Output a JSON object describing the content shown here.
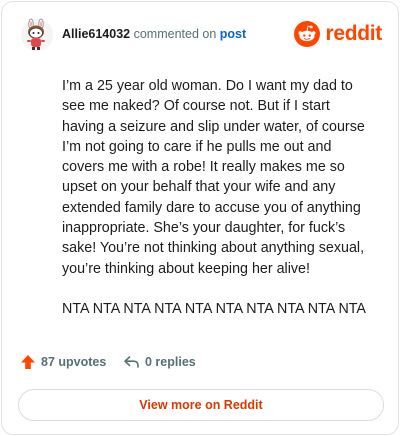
{
  "header": {
    "username": "Allie614032",
    "action_text": "commented on",
    "post_link": "post",
    "brand_wordmark": "reddit"
  },
  "comment": {
    "paragraphs": [
      "I’m a 25 year old woman. Do I want my dad to see me naked? Of course not. But if I start having a seizure and slip under water, of course I’m not going to care if he pulls me out and covers me with a robe! It really makes me so upset on your behalf that your wife and any extended family dare to accuse you of anything inappropriate. She’s your daughter, for fuck’s sake! You’re not thinking about anything sexual, you’re thinking about keeping her alive!",
      "NTA NTA NTA NTA NTA NTA NTA NTA NTA NTA"
    ]
  },
  "footer": {
    "upvotes_label": "87 upvotes",
    "replies_label": "0 replies"
  },
  "actions": {
    "view_more_label": "View more on Reddit"
  },
  "colors": {
    "brand": "#ff4500",
    "link": "#0a66c2",
    "muted": "#576f76",
    "button_text": "#d93a00"
  },
  "icons": {
    "avatar": "snoo-avatar",
    "logo": "reddit-snoo-icon",
    "upvote": "upvote-arrow-icon",
    "reply": "reply-arrow-icon"
  }
}
